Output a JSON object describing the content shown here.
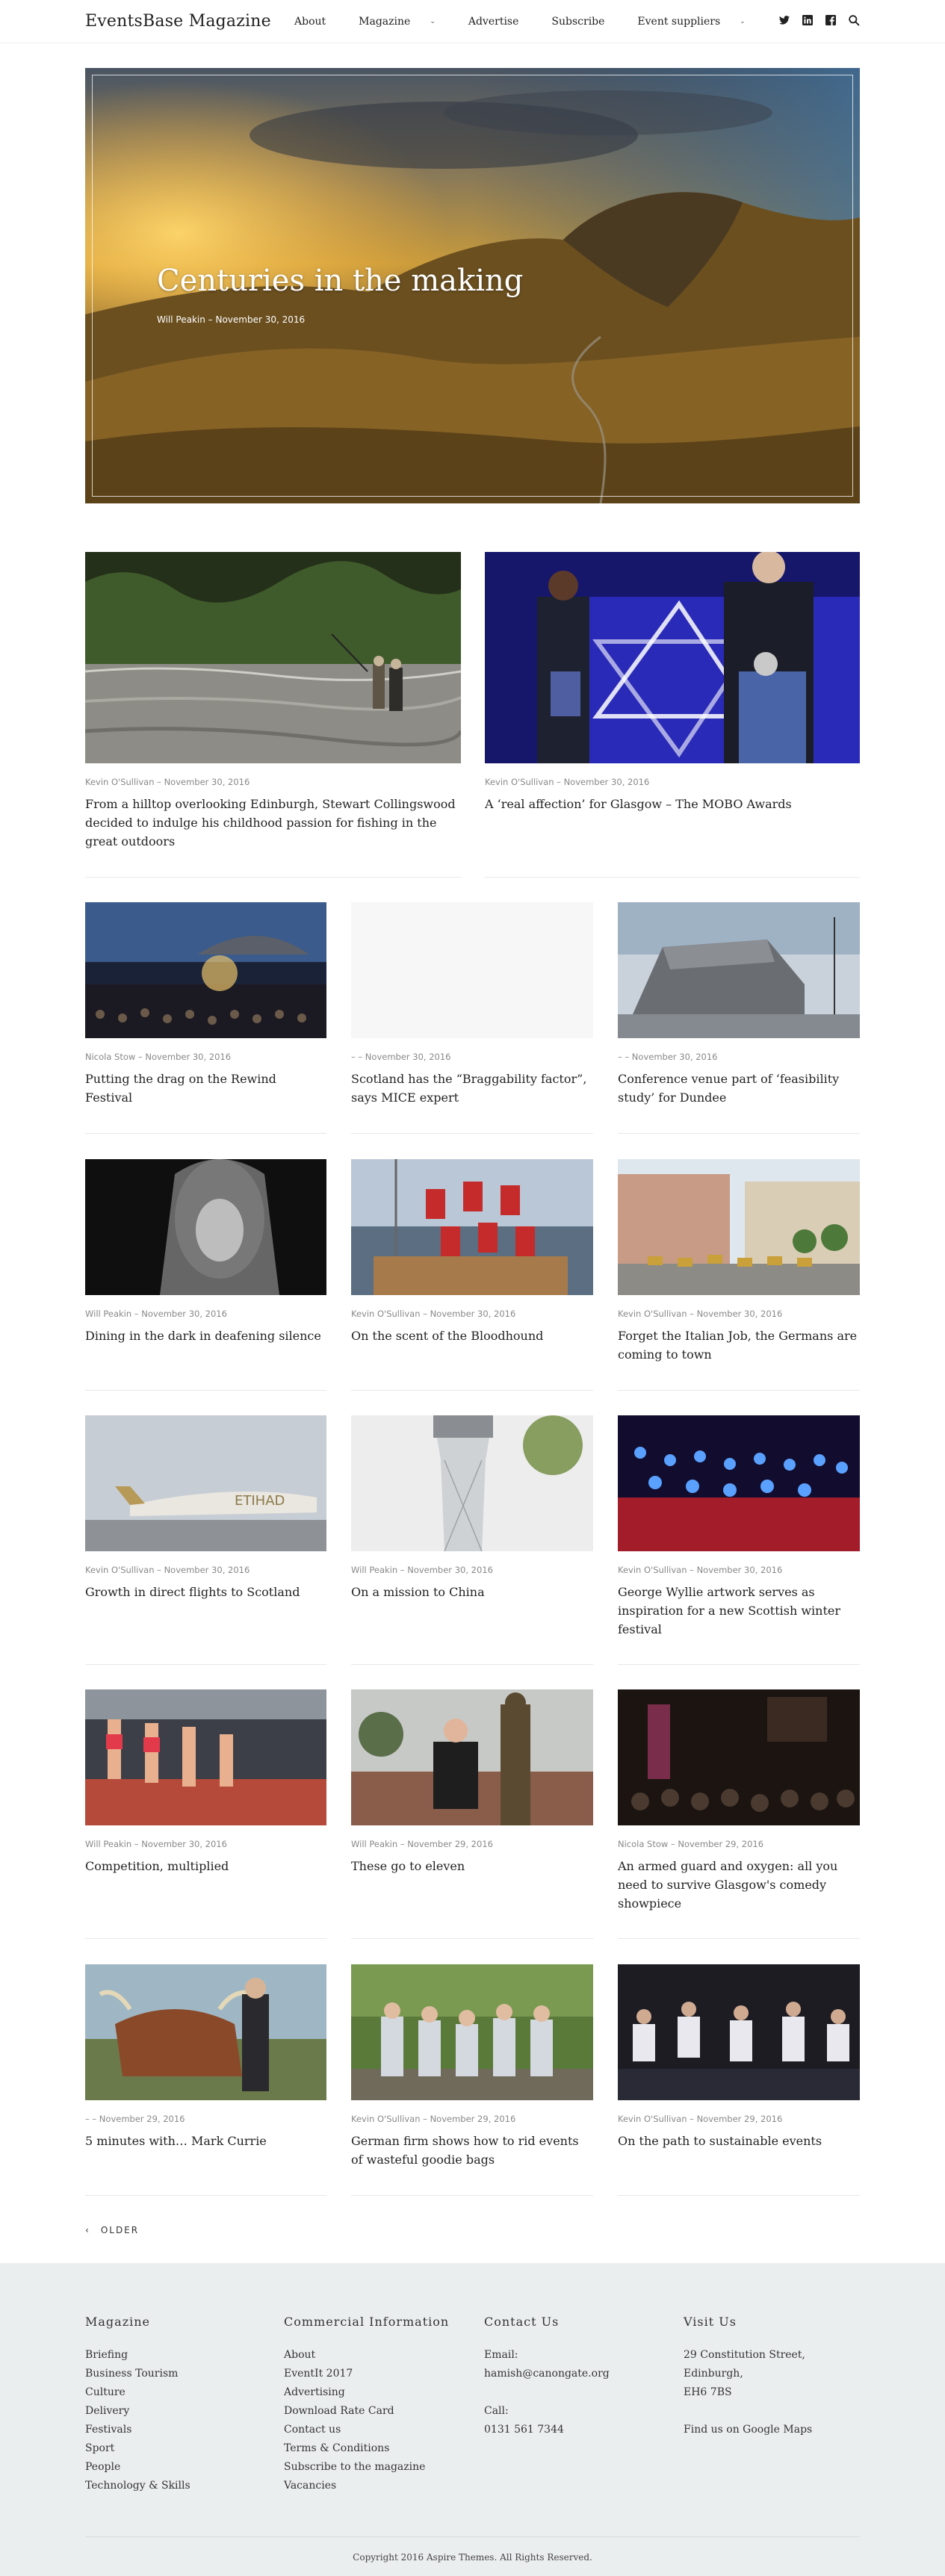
{
  "header": {
    "logo": "EventsBase Magazine",
    "nav": [
      {
        "label": "About",
        "dropdown": false
      },
      {
        "label": "Magazine",
        "dropdown": true
      },
      {
        "label": "Advertise",
        "dropdown": false
      },
      {
        "label": "Subscribe",
        "dropdown": false
      },
      {
        "label": "Event suppliers",
        "dropdown": true
      }
    ],
    "social_icons": [
      "twitter-icon",
      "linkedin-icon",
      "facebook-icon",
      "search-icon"
    ]
  },
  "hero": {
    "title": "Centuries in the making",
    "meta": "Will Peakin – November 30, 2016"
  },
  "articles": [
    {
      "meta": "Kevin O'Sullivan – November 30, 2016",
      "title": "From a hilltop overlooking Edinburgh, Stewart Collingswood decided to indulge his childhood passion for fishing in the great outdoors"
    },
    {
      "meta": "Kevin O'Sullivan – November 30, 2016",
      "title": "A ‘real affection’ for Glasgow – The MOBO Awards"
    },
    {
      "meta": "Nicola Stow – November 30, 2016",
      "title": "Putting the drag on the Rewind Festival"
    },
    {
      "meta": "– – November 30, 2016",
      "title": "Scotland has the “Braggability factor”, says MICE expert"
    },
    {
      "meta": "– – November 30, 2016",
      "title": "Conference venue part of ‘feasibility study’ for Dundee"
    },
    {
      "meta": "Will Peakin – November 30, 2016",
      "title": "Dining in the dark in deafening silence"
    },
    {
      "meta": "Kevin O'Sullivan – November 30, 2016",
      "title": "On the scent of the Bloodhound"
    },
    {
      "meta": "Kevin O'Sullivan – November 30, 2016",
      "title": "Forget the Italian Job, the Germans are coming to town"
    },
    {
      "meta": "Kevin O'Sullivan – November 30, 2016",
      "title": "Growth in direct flights to Scotland"
    },
    {
      "meta": "Will Peakin – November 30, 2016",
      "title": "On a mission to China"
    },
    {
      "meta": "Kevin O'Sullivan – November 30, 2016",
      "title": "George Wyllie artwork serves as inspiration for a new Scottish winter festival"
    },
    {
      "meta": "Will Peakin – November 30, 2016",
      "title": "Competition, multiplied"
    },
    {
      "meta": "Will Peakin – November 29, 2016",
      "title": "These go to eleven"
    },
    {
      "meta": "Nicola Stow – November 29, 2016",
      "title": "An armed guard and oxygen: all you need to survive Glasgow's comedy showpiece"
    },
    {
      "meta": "– – November 29, 2016",
      "title": "5 minutes with… Mark Currie"
    },
    {
      "meta": "Kevin O'Sullivan – November 29, 2016",
      "title": "German firm shows how to rid events of wasteful goodie bags"
    },
    {
      "meta": "Kevin O'Sullivan – November 29, 2016",
      "title": "On the path to sustainable events"
    }
  ],
  "pagination": {
    "older_label": "OLDER"
  },
  "footer": {
    "columns": [
      {
        "heading": "Magazine",
        "items": [
          "Briefing",
          "Business Tourism",
          "Culture",
          "Delivery",
          "Festivals",
          "Sport",
          "People",
          "Technology & Skills"
        ]
      },
      {
        "heading": "Commercial Information",
        "items": [
          "About",
          "EventIt 2017",
          "Advertising",
          "Download Rate Card",
          "Contact us",
          "Terms & Conditions",
          "Subscribe to the magazine",
          "Vacancies"
        ]
      },
      {
        "heading": "Contact Us",
        "items": [
          "Email:",
          "hamish@canongate.org",
          "",
          "Call:",
          "0131 561 7344"
        ]
      },
      {
        "heading": "Visit Us",
        "items": [
          "29 Constitution Street,",
          "Edinburgh,",
          "EH6 7BS",
          "",
          "Find us on Google Maps"
        ]
      }
    ],
    "copyright": "Copyright 2016 Aspire Themes. All Rights Reserved."
  }
}
